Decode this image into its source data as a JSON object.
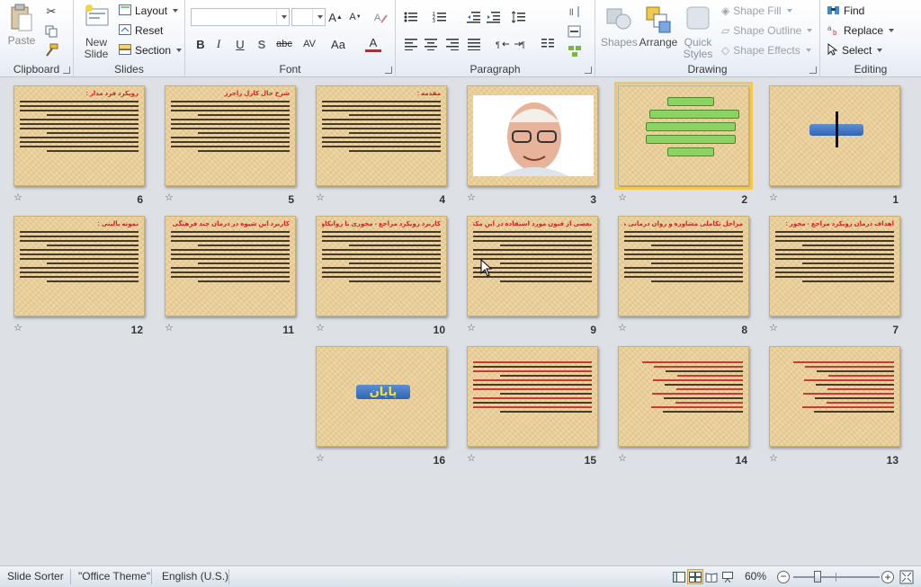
{
  "ribbon": {
    "clipboard": {
      "label": "Clipboard",
      "paste": "Paste"
    },
    "slides": {
      "label": "Slides",
      "new_slide_line1": "New",
      "new_slide_line2": "Slide",
      "layout": "Layout",
      "reset": "Reset",
      "section": "Section"
    },
    "font": {
      "label": "Font",
      "bold": "B",
      "italic": "I",
      "underline": "U",
      "shadow": "S",
      "strike": "abc",
      "spacing": "AV",
      "case": "Aa",
      "color": "A"
    },
    "paragraph": {
      "label": "Paragraph"
    },
    "drawing": {
      "label": "Drawing",
      "shapes": "Shapes",
      "arrange": "Arrange",
      "quick_styles_line1": "Quick",
      "quick_styles_line2": "Styles",
      "shape_fill": "Shape Fill",
      "shape_outline": "Shape Outline",
      "shape_effects": "Shape Effects"
    },
    "editing": {
      "label": "Editing",
      "find": "Find",
      "replace": "Replace",
      "select": "Select"
    }
  },
  "slides": [
    {
      "num": "1",
      "kind": "bar"
    },
    {
      "num": "2",
      "kind": "diagram",
      "selected": true
    },
    {
      "num": "3",
      "kind": "photo"
    },
    {
      "num": "4",
      "kind": "text",
      "title": "مقدمه :"
    },
    {
      "num": "5",
      "kind": "text",
      "title": "شرح حال کارل راجرز"
    },
    {
      "num": "6",
      "kind": "text",
      "title": "رویکرد فرد مدار :"
    },
    {
      "num": "7",
      "kind": "text",
      "title": "اهداف درمان رویکرد مراجع - محور :"
    },
    {
      "num": "8",
      "kind": "text",
      "title": "مراحل تکاملی مشاوره و روان درمانی مراجع محوری :"
    },
    {
      "num": "9",
      "kind": "text",
      "title": "بعضی از فنون مورد استفاده در این مکتب مراجع محور :"
    },
    {
      "num": "10",
      "kind": "text",
      "title": "کاربرد رویکرد مراجع - محوری با روانکاوی و تحلیل گروهی :"
    },
    {
      "num": "11",
      "kind": "text",
      "title": "کاربرد این شیوه در درمان چند فرهنگی :"
    },
    {
      "num": "12",
      "kind": "text",
      "title": "نمونه بالینی :"
    },
    {
      "num": "13",
      "kind": "text2",
      "title": ""
    },
    {
      "num": "14",
      "kind": "text2",
      "title": ""
    },
    {
      "num": "15",
      "kind": "text3",
      "title": ""
    },
    {
      "num": "16",
      "kind": "end",
      "end_text": "پایان"
    }
  ],
  "status": {
    "view": "Slide Sorter",
    "theme": "\"Office Theme\"",
    "language": "English (U.S.)",
    "zoom": "60%",
    "zoom_level": 0.6
  }
}
